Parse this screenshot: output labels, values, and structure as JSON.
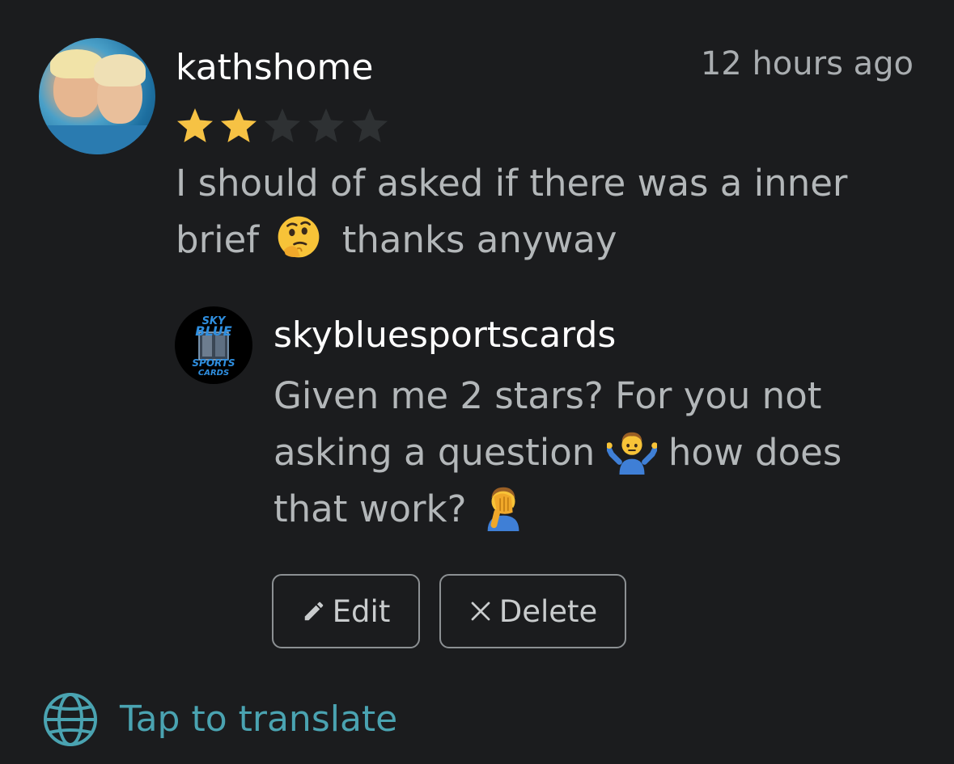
{
  "review": {
    "username": "kathshome",
    "timestamp": "12 hours ago",
    "rating": 2,
    "rating_max": 5,
    "text_before_emoji": "I should of asked if there was a inner brief",
    "emoji": "thinking-face",
    "text_after_emoji": "thanks anyway"
  },
  "reply": {
    "username": "skybluesportscards",
    "text_part1": "Given me 2 stars? For you not asking a question",
    "emoji1": "person-shrugging",
    "text_part2": "how does that work?",
    "emoji2": "person-facepalming",
    "avatar_logo_text": "SKY BLUE SPORTS CARDS"
  },
  "actions": {
    "edit_label": "Edit",
    "delete_label": "Delete"
  },
  "translate": {
    "label": "Tap to translate"
  },
  "colors": {
    "background": "#1b1c1e",
    "star_filled": "#f6c244",
    "star_empty": "#2e3133",
    "link": "#4aa3b1",
    "muted_text": "#b3b7b9"
  }
}
